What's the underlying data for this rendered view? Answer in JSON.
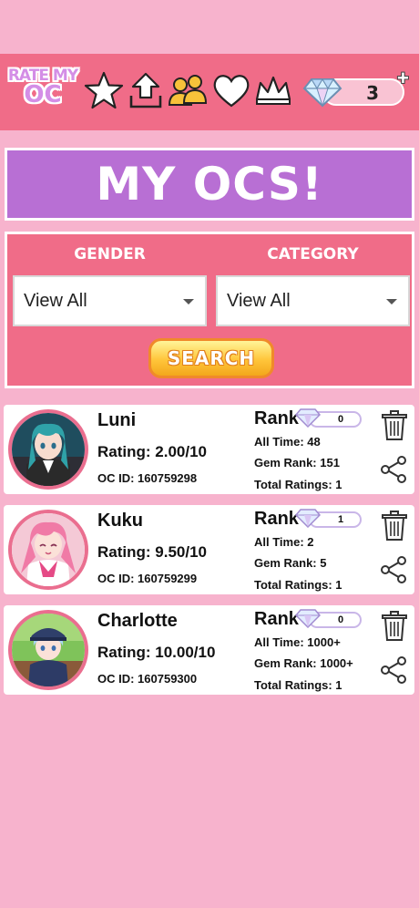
{
  "app": {
    "logo_line1": "RATE MY",
    "logo_line2": "OC"
  },
  "nav": {
    "icons": [
      "star-icon",
      "upload-icon",
      "friends-icon",
      "heart-icon",
      "crown-icon"
    ],
    "gem_count": "3",
    "plus_label": "+"
  },
  "page": {
    "title": "MY OCS!"
  },
  "filters": {
    "gender_label": "GENDER",
    "category_label": "CATEGORY",
    "gender_value": "View All",
    "category_value": "View All",
    "search_label": "SEARCH"
  },
  "colors": {
    "background": "#f7b3cd",
    "header": "#f06c88",
    "title_banner": "#b86fd4",
    "search_button": "#ffc53a"
  },
  "ocs": [
    {
      "name": "Luni",
      "rating": "Rating: 2.00/10",
      "oc_id": "OC ID: 160759298",
      "rank_label": "Rank",
      "gems": "0",
      "all_time": "All Time: 48",
      "gem_rank": "Gem Rank: 151",
      "total_ratings": "Total Ratings: 1"
    },
    {
      "name": "Kuku",
      "rating": "Rating: 9.50/10",
      "oc_id": "OC ID: 160759299",
      "rank_label": "Rank",
      "gems": "1",
      "all_time": "All Time: 2",
      "gem_rank": "Gem Rank: 5",
      "total_ratings": "Total Ratings: 1"
    },
    {
      "name": "Charlotte",
      "rating": "Rating: 10.00/10",
      "oc_id": "OC ID: 160759300",
      "rank_label": "Rank",
      "gems": "0",
      "all_time": "All Time: 1000+",
      "gem_rank": "Gem Rank: 1000+",
      "total_ratings": "Total Ratings: 1"
    }
  ]
}
